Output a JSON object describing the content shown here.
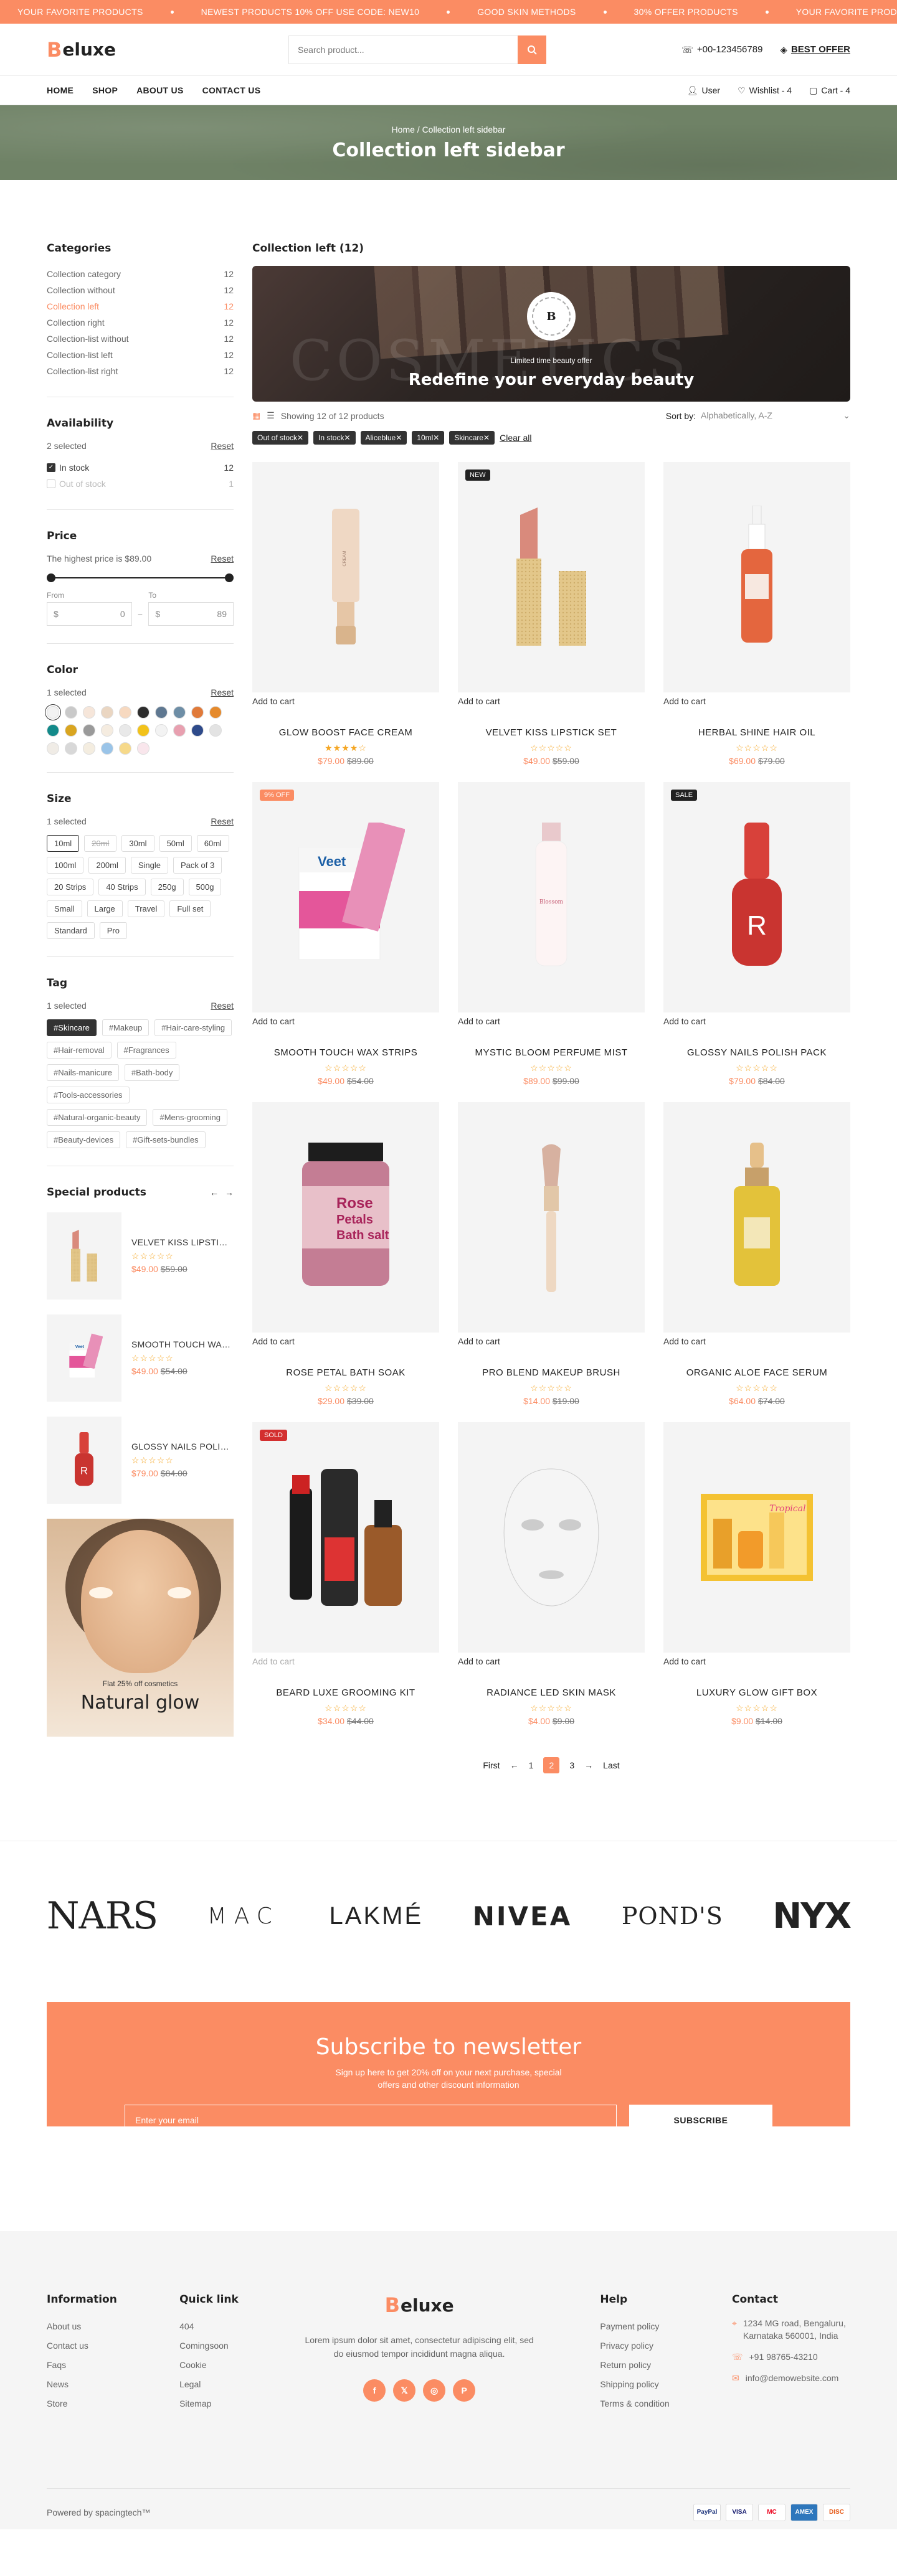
{
  "announcement": [
    "YOUR FAVORITE PRODUCTS",
    "NEWEST PRODUCTS 10% OFF USE CODE: NEW10",
    "GOOD SKIN METHODS",
    "30% OFFER PRODUCTS",
    "YOUR FAVORITE PRODUCTS"
  ],
  "header": {
    "logo": "eluxe",
    "logo_mark": "B",
    "search_placeholder": "Search product...",
    "phone": "+00-123456789",
    "best_offer": "BEST OFFER"
  },
  "nav": {
    "links": [
      "HOME",
      "SHOP",
      "ABOUT US",
      "CONTACT US"
    ],
    "user": "User",
    "wishlist": "Wishlist - 4",
    "cart": "Cart - 4"
  },
  "banner": {
    "breadcrumb": "Home / Collection left sidebar",
    "title": "Collection left sidebar"
  },
  "sidebar": {
    "categories_title": "Categories",
    "categories": [
      {
        "name": "Collection category",
        "count": "12"
      },
      {
        "name": "Collection without",
        "count": "12"
      },
      {
        "name": "Collection left",
        "count": "12"
      },
      {
        "name": "Collection right",
        "count": "12"
      },
      {
        "name": "Collection-list without",
        "count": "12"
      },
      {
        "name": "Collection-list left",
        "count": "12"
      },
      {
        "name": "Collection-list right",
        "count": "12"
      }
    ],
    "availability_title": "Availability",
    "availability_selected": "2 selected",
    "reset": "Reset",
    "availability": [
      {
        "name": "In stock",
        "count": "12"
      },
      {
        "name": "Out of stock",
        "count": "1"
      }
    ],
    "price_title": "Price",
    "price_highest": "The highest price is $89.00",
    "price_from_label": "From",
    "price_to_label": "To",
    "price_from": "0",
    "price_to": "89",
    "currency": "$",
    "color_title": "Color",
    "color_selected": "1 selected",
    "colors": [
      "#f2f2f2",
      "#c9c9c9",
      "#f6e6da",
      "#ead6c2",
      "#f7d9c0",
      "#2d2d2d",
      "#5f7891",
      "#6e8ea6",
      "#e07a3a",
      "#e58a2c",
      "#138a8a",
      "#d9a520",
      "#9a9a9a",
      "#f5ece0",
      "#e9e9e9",
      "#f2c21a",
      "#f3f3f3",
      "#e8a0b0",
      "#2e4a8a",
      "#e3e3e3",
      "#f0ece6",
      "#d8d8d8",
      "#f4ede0",
      "#9ac4e8",
      "#f6d98a",
      "#f9e6ec"
    ],
    "size_title": "Size",
    "size_selected": "1 selected",
    "sizes": [
      "10ml",
      "20ml",
      "30ml",
      "50ml",
      "60ml",
      "100ml",
      "200ml",
      "Single",
      "Pack of 3",
      "20 Strips",
      "40 Strips",
      "250g",
      "500g",
      "Small",
      "Large",
      "Travel",
      "Full set",
      "Standard",
      "Pro"
    ],
    "tag_title": "Tag",
    "tag_selected": "1 selected",
    "tags": [
      "#Skincare",
      "#Makeup",
      "#Hair-care-styling",
      "#Hair-removal",
      "#Fragrances",
      "#Nails-manicure",
      "#Bath-body",
      "#Tools-accessories",
      "#Natural-organic-beauty",
      "#Mens-grooming",
      "#Beauty-devices",
      "#Gift-sets-bundles"
    ],
    "special_title": "Special products",
    "special": [
      {
        "name": "VELVET KISS LIPSTICK SET",
        "new": "$49.00",
        "old": "$59.00"
      },
      {
        "name": "SMOOTH TOUCH WAX STRIPS",
        "new": "$49.00",
        "old": "$54.00"
      },
      {
        "name": "GLOSSY NAILS POLISH PACK",
        "new": "$79.00",
        "old": "$84.00"
      }
    ],
    "banner_sub": "Flat 25% off cosmetics",
    "banner_title": "Natural glow"
  },
  "content": {
    "title": "Collection left (12)",
    "hero_badge": "B",
    "hero_sub": "Limited time beauty offer",
    "hero_title": "Redefine your everyday beauty",
    "hero_bg_word": "COSMETICS",
    "showing": "Showing 12 of 12 products",
    "sort_label": "Sort by:",
    "sort_value": "Alphabetically, A-Z",
    "chips": [
      "Out of stock✕",
      "In stock✕",
      "Aliceblue✕",
      "10ml✕",
      "Skincare✕"
    ],
    "clear_all": "Clear all",
    "add_to_cart": "Add to cart"
  },
  "products": [
    {
      "name": "GLOW BOOST FACE CREAM",
      "new": "$79.00",
      "old": "$89.00",
      "badge": "",
      "rating": 4,
      "art": "tube"
    },
    {
      "name": "VELVET KISS LIPSTICK SET",
      "new": "$49.00",
      "old": "$59.00",
      "badge": "NEW",
      "rating": 0,
      "art": "lipstick"
    },
    {
      "name": "HERBAL SHINE HAIR OIL",
      "new": "$69.00",
      "old": "$79.00",
      "badge": "",
      "rating": 0,
      "art": "serum-orange"
    },
    {
      "name": "SMOOTH TOUCH WAX STRIPS",
      "new": "$49.00",
      "old": "$54.00",
      "badge": "9% OFF",
      "rating": 0,
      "art": "wax"
    },
    {
      "name": "MYSTIC BLOOM PERFUME MIST",
      "new": "$89.00",
      "old": "$99.00",
      "badge": "",
      "rating": 0,
      "art": "mist"
    },
    {
      "name": "GLOSSY NAILS POLISH PACK",
      "new": "$79.00",
      "old": "$84.00",
      "badge": "SALE",
      "rating": 0,
      "art": "polish"
    },
    {
      "name": "ROSE PETAL BATH SOAK",
      "new": "$29.00",
      "old": "$39.00",
      "badge": "",
      "rating": 0,
      "art": "jar"
    },
    {
      "name": "PRO BLEND MAKEUP BRUSH",
      "new": "$14.00",
      "old": "$19.00",
      "badge": "",
      "rating": 0,
      "art": "brush"
    },
    {
      "name": "ORGANIC ALOE FACE SERUM",
      "new": "$64.00",
      "old": "$74.00",
      "badge": "",
      "rating": 0,
      "art": "serum-yellow"
    },
    {
      "name": "BEARD LUXE GROOMING KIT",
      "new": "$34.00",
      "old": "$44.00",
      "badge": "SOLD",
      "rating": 0,
      "art": "beard"
    },
    {
      "name": "RADIANCE LED SKIN MASK",
      "new": "$4.00",
      "old": "$9.00",
      "badge": "",
      "rating": 0,
      "art": "mask"
    },
    {
      "name": "LUXURY GLOW GIFT BOX",
      "new": "$9.00",
      "old": "$14.00",
      "badge": "",
      "rating": 0,
      "art": "gift"
    }
  ],
  "pager": {
    "first": "First",
    "pages": [
      "1",
      "2",
      "3"
    ],
    "current": "2",
    "last": "Last"
  },
  "brands": [
    "NARS",
    "MAC",
    "LAKMÉ",
    "NIVEA",
    "POND'S",
    "NYX"
  ],
  "newsletter": {
    "title": "Subscribe to newsletter",
    "text": "Sign up here to get 20% off on your next purchase, special offers and other discount information",
    "placeholder": "Enter your email",
    "button": "SUBSCRIBE"
  },
  "footer": {
    "info_title": "Information",
    "info": [
      "About us",
      "Contact us",
      "Faqs",
      "News",
      "Store"
    ],
    "quick_title": "Quick link",
    "quick": [
      "404",
      "Comingsoon",
      "Cookie",
      "Legal",
      "Sitemap"
    ],
    "about": "Lorem ipsum dolor sit amet, consectetur adipiscing elit, sed do eiusmod tempor incididunt magna aliqua.",
    "help_title": "Help",
    "help": [
      "Payment policy",
      "Privacy policy",
      "Return policy",
      "Shipping policy",
      "Terms & condition"
    ],
    "contact_title": "Contact",
    "address": "1234 MG road, Bengaluru, Karnataka 560001, India",
    "phone": "+91 98765-43210",
    "email": "info@demowebsite.com",
    "powered": "Powered by spacingtech™",
    "payments": [
      "PayPal",
      "VISA",
      "MC",
      "AMEX",
      "DISC"
    ]
  }
}
